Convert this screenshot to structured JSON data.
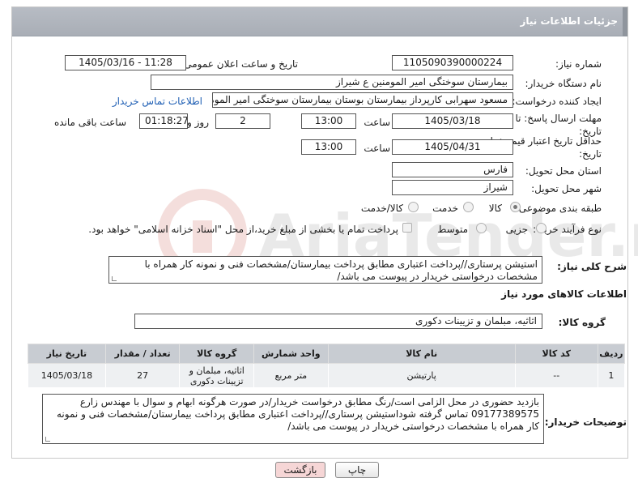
{
  "header": {
    "title": "جزئیات اطلاعات نیاز"
  },
  "fields": {
    "need_number_label": "شماره نیاز:",
    "need_number": "1105090390000224",
    "announce_label": "تاریخ و ساعت اعلان عمومی:",
    "announce_value": "1405/03/16 - 11:28",
    "buyer_org_label": "نام دستگاه خریدار:",
    "buyer_org": "بیمارستان سوختگی امیر المومنین  ع  شیراز",
    "requester_label": "ایجاد کننده درخواست:",
    "requester": "مسعود سهرابی کارپرداز بیمارستان بوستان بیمارستان سوختگی امیر المومنین",
    "contact_link": "اطلاعات تماس خریدار",
    "deadline_label": "مهلت ارسال پاسخ: تا تاریخ:",
    "deadline_date": "1405/03/18",
    "time_label": "ساعت",
    "deadline_time": "13:00",
    "days_value": "2",
    "days_label": "روز و",
    "remaining_time": "01:18:27",
    "remaining_label": "ساعت باقی مانده",
    "price_validity_label": "حداقل تاریخ اعتبار قیمت: تا تاریخ:",
    "validity_date": "1405/04/31",
    "validity_time": "13:00",
    "province_label": "استان محل تحویل:",
    "province": "فارس",
    "city_label": "شهر محل تحویل:",
    "city": "شیراز",
    "category_label": "طبقه بندی موضوعی:",
    "category_options": [
      "کالا",
      "خدمت",
      "کالا/خدمت"
    ],
    "process_label": "نوع فرآیند خرید :",
    "process_options": [
      "جزیی",
      "متوسط"
    ],
    "payment_note": "پرداخت تمام یا بخشی از مبلغ خرید،از محل \"اسناد خزانه اسلامی\" خواهد بود.",
    "description_label": "شرح کلی نیاز:",
    "description": "استیشن پرستاری//پرداخت اعتباری مطابق پرداخت بیمارستان/مشخصات فنی و نمونه کار همراه با مشخصات درخواستی خریدار در پیوست می باشد/",
    "goods_info_title": "اطلاعات کالاهای مورد نیاز",
    "goods_group_label": "گروه کالا:",
    "goods_group": "اثاثیه، مبلمان و تزیینات دکوری"
  },
  "table": {
    "headers": [
      "ردیف",
      "کد کالا",
      "نام کالا",
      "واحد شمارش",
      "گروه کالا",
      "تعداد / مقدار",
      "تاریخ نیاز"
    ],
    "rows": [
      [
        "1",
        "--",
        "پارتیشن",
        "متر مربع",
        "اثاثیه، مبلمان و تزیینات دکوری",
        "27",
        "1405/03/18"
      ]
    ]
  },
  "buyer_notes_label": "توضیحات خریدار:",
  "buyer_notes": "بازدید حضوری در محل الزامی است/رنگ مطابق درخواست خریدار/در صورت هرگونه ابهام و سوال با مهندس زارع 09177389575 تماس گرفته شوداستیشن پرستاری//پرداخت اعتباری مطابق پرداخت بیمارستان/مشخصات فنی و نمونه کار همراه با مشخصات درخواستی خریدار در پیوست می باشد/",
  "buttons": {
    "print": "چاپ",
    "back": "بازگشت"
  },
  "colors": {
    "header_bg": "#b0b5bd",
    "link": "#1f5fb4",
    "back_btn": "#f6d6d6",
    "table_header": "#c8ccd2"
  }
}
